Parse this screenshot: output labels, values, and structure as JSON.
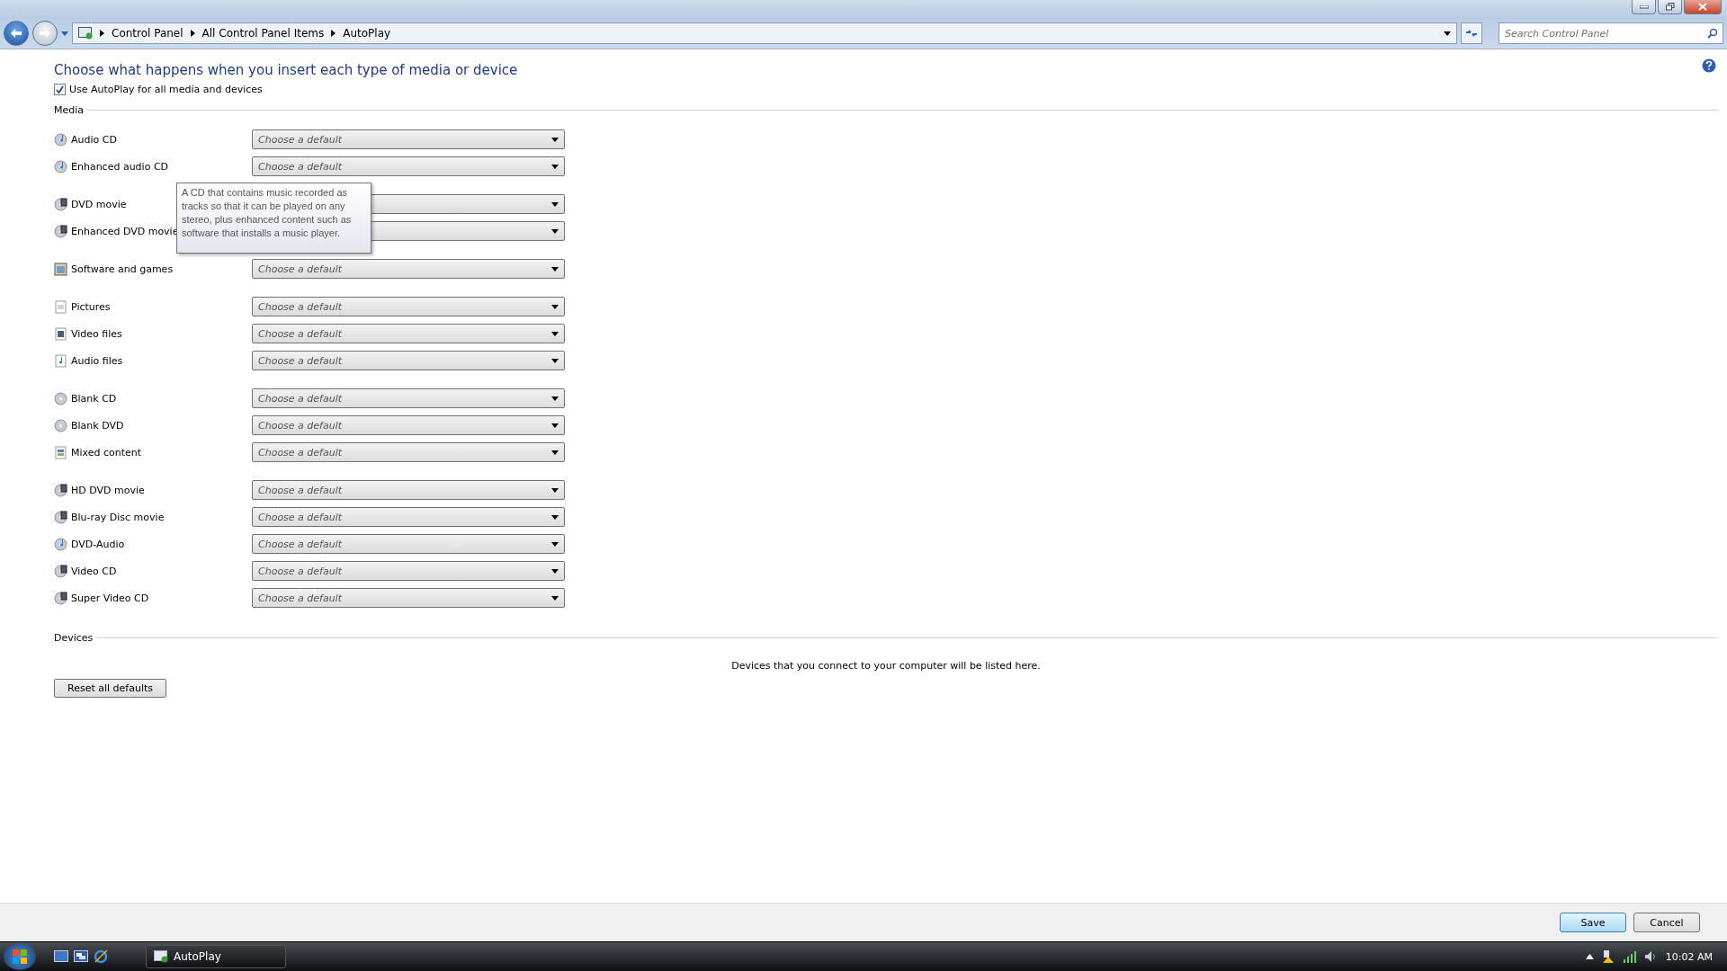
{
  "address_bar": {
    "breadcrumb": [
      "Control Panel",
      "All Control Panel Items",
      "AutoPlay"
    ],
    "search": {
      "placeholder": "Search Control Panel"
    }
  },
  "heading": "Choose what happens when you insert each type of media or device",
  "use_autoplay": {
    "label": "Use AutoPlay for all media and devices",
    "checked": true
  },
  "media": {
    "title": "Media",
    "groups": [
      [
        {
          "label": "Audio CD",
          "kind": "cd",
          "value": "Choose a default"
        },
        {
          "label": "Enhanced audio CD",
          "kind": "cd",
          "value": "Choose a default"
        }
      ],
      [
        {
          "label": "DVD movie",
          "kind": "dvd"
        },
        {
          "label": "Enhanced DVD movie",
          "kind": "dvd"
        }
      ],
      [
        {
          "label": "Software and games",
          "kind": "software",
          "value": "Choose a default"
        }
      ],
      [
        {
          "label": "Pictures",
          "kind": "pictures",
          "value": "Choose a default"
        },
        {
          "label": "Video files",
          "kind": "video",
          "value": "Choose a default"
        },
        {
          "label": "Audio files",
          "kind": "audio",
          "value": "Choose a default"
        }
      ],
      [
        {
          "label": "Blank CD",
          "kind": "blank",
          "value": "Choose a default"
        },
        {
          "label": "Blank DVD",
          "kind": "blank",
          "value": "Choose a default"
        },
        {
          "label": "Mixed content",
          "kind": "mixed",
          "value": "Choose a default"
        }
      ],
      [
        {
          "label": "HD DVD movie",
          "kind": "dvd",
          "value": "Choose a default"
        },
        {
          "label": "Blu-ray Disc movie",
          "kind": "dvd",
          "value": "Choose a default"
        },
        {
          "label": "DVD-Audio",
          "kind": "cd",
          "value": "Choose a default"
        },
        {
          "label": "Video CD",
          "kind": "dvd",
          "value": "Choose a default"
        },
        {
          "label": "Super Video CD",
          "kind": "dvd",
          "value": "Choose a default"
        }
      ]
    ]
  },
  "tooltip": "A CD that contains music recorded as tracks so that it can be played on any stereo, plus enhanced content such as software that installs a music player.",
  "devices": {
    "title": "Devices",
    "message": "Devices that you connect to your computer will be listed here."
  },
  "reset_button": "Reset all defaults",
  "footer": {
    "buttons": [
      {
        "label": "Save",
        "selected": true
      },
      {
        "label": "Cancel",
        "selected": false
      }
    ]
  },
  "taskbar": {
    "task": "AutoPlay",
    "clock": "10:02 AM"
  }
}
